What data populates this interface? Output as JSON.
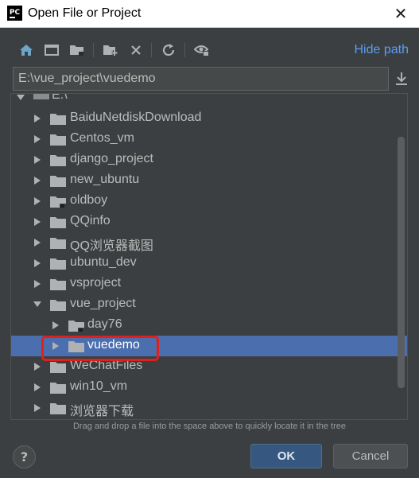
{
  "window": {
    "title": "Open File or Project",
    "app_icon_text": "PC"
  },
  "toolbar": {
    "buttons": [
      "home-icon",
      "desktop-icon",
      "project-folder-icon",
      "new-folder-icon",
      "delete-icon",
      "refresh-icon",
      "show-hidden-icon"
    ],
    "hide_path_label": "Hide path"
  },
  "path": {
    "value": "E:\\vue_project\\vuedemo"
  },
  "tree": {
    "root_label": "E:\\",
    "items": [
      {
        "label": "BaiduNetdiskDownload",
        "expanded": false
      },
      {
        "label": "Centos_vm",
        "expanded": false
      },
      {
        "label": "django_project",
        "expanded": false
      },
      {
        "label": "new_ubuntu",
        "expanded": false
      },
      {
        "label": "oldboy",
        "expanded": false
      },
      {
        "label": "QQinfo",
        "expanded": false
      },
      {
        "label": "QQ浏览器截图",
        "expanded": false
      },
      {
        "label": "ubuntu_dev",
        "expanded": false
      },
      {
        "label": "vsproject",
        "expanded": false
      },
      {
        "label": "vue_project",
        "expanded": true
      },
      {
        "label": "day76",
        "expanded": false
      },
      {
        "label": "vuedemo",
        "expanded": false,
        "selected": true
      },
      {
        "label": "WeChatFiles",
        "expanded": false
      },
      {
        "label": "win10_vm",
        "expanded": false
      },
      {
        "label": "浏览器下载",
        "expanded": false
      }
    ]
  },
  "hint": "Drag and drop a file into the space above to quickly locate it in the tree",
  "buttons": {
    "help": "?",
    "ok": "OK",
    "cancel": "Cancel"
  },
  "colors": {
    "background": "#3c3f41",
    "selection": "#4b6eaf",
    "link": "#589df6",
    "highlight_box": "#e0201a",
    "ok_button": "#365880"
  }
}
